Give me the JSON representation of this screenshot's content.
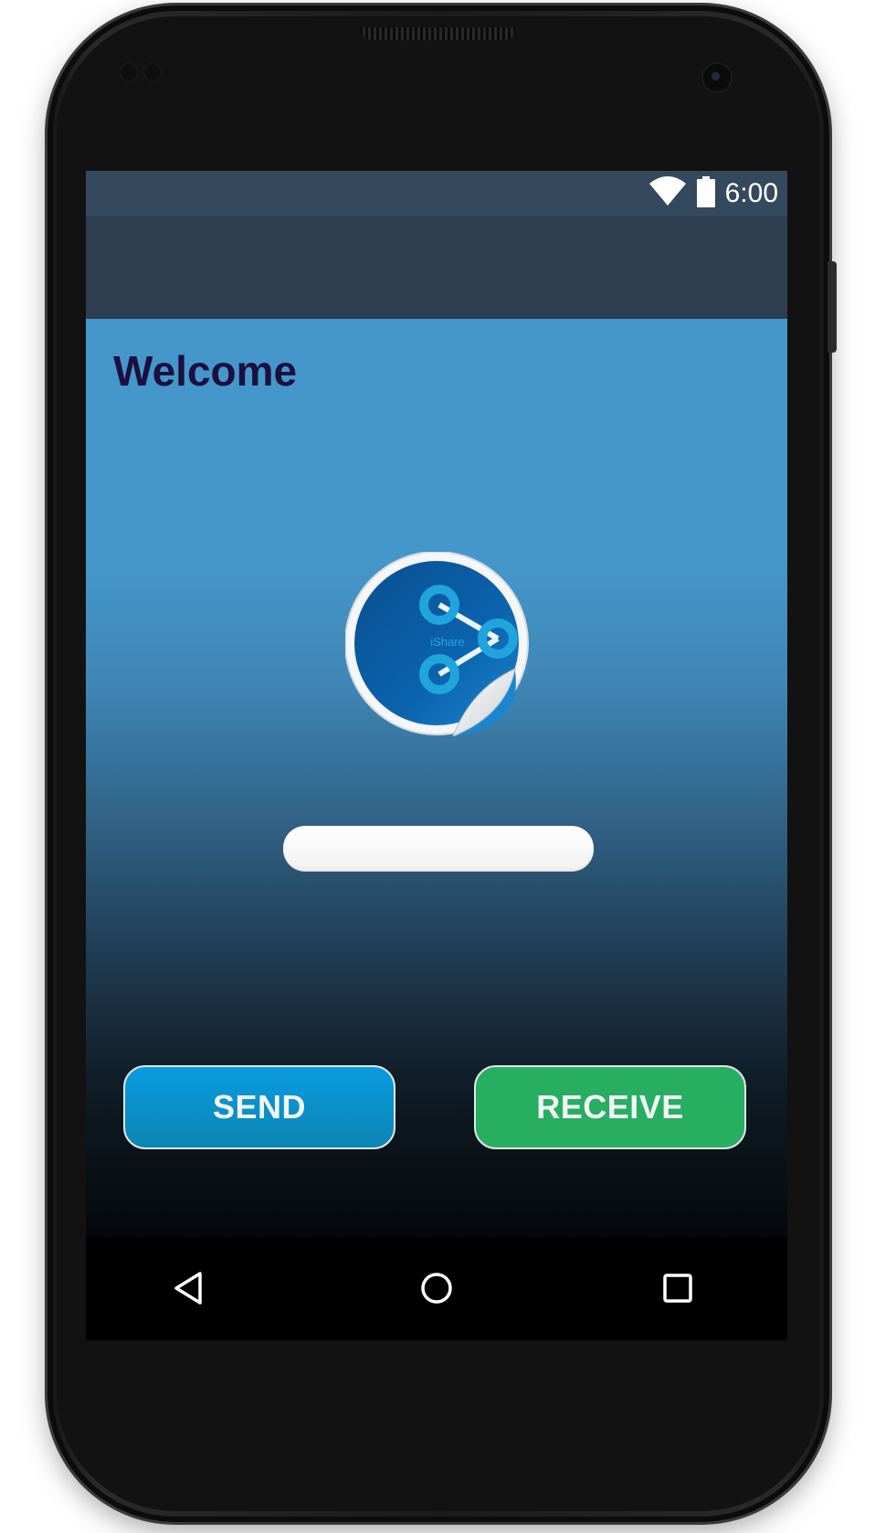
{
  "status_bar": {
    "time": "6:00",
    "icons": [
      "wifi-icon",
      "battery-icon"
    ]
  },
  "main": {
    "title": "Welcome",
    "logo": {
      "text": "iShare",
      "icon": "share-sticker-logo"
    },
    "text_field": {
      "value": "",
      "placeholder": ""
    },
    "buttons": {
      "send_label": "SEND",
      "receive_label": "RECEIVE"
    }
  },
  "nav_bar": {
    "buttons": [
      "back-icon",
      "home-icon",
      "recents-icon"
    ]
  },
  "colors": {
    "status_bar": "#34495e",
    "toolbar": "#2c3e50",
    "background_top": "#4597cb",
    "title_text": "#1c1040",
    "send_button": "#0a9be0",
    "receive_button": "#27ae60"
  }
}
